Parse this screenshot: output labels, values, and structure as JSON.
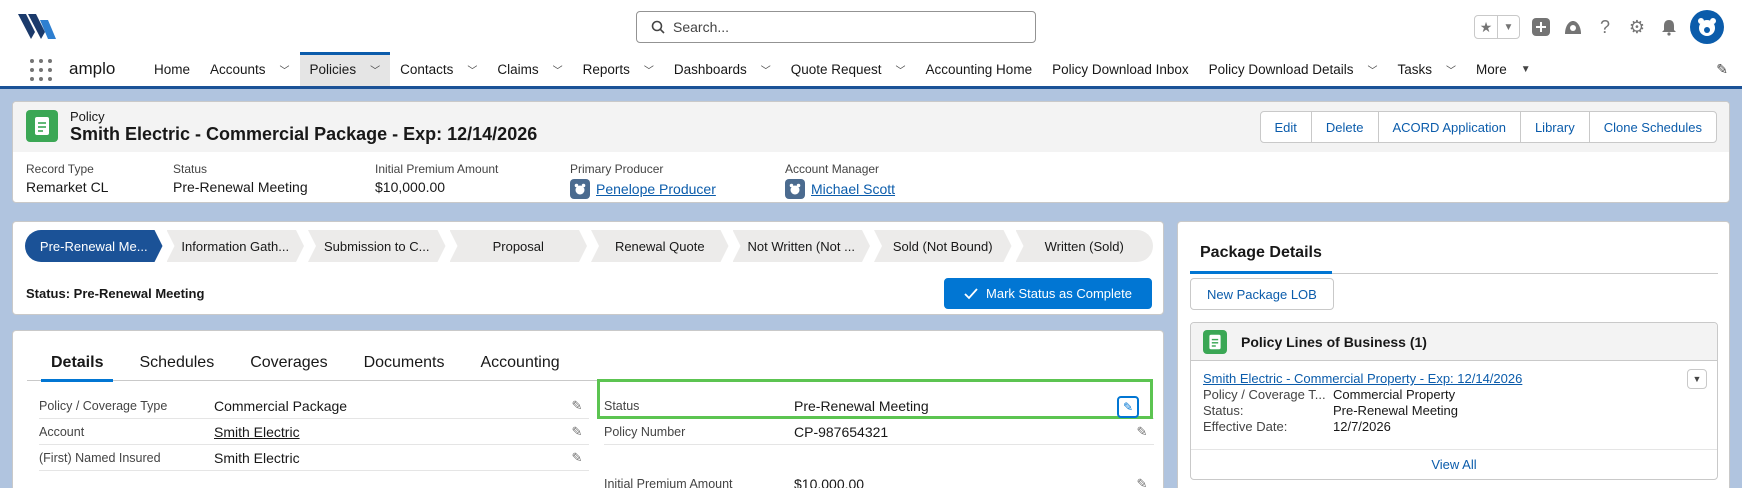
{
  "topbar": {
    "search_placeholder": "Search...",
    "icons": [
      "star-icon",
      "chevron-down-icon",
      "add-icon",
      "trailhead-icon",
      "help-icon",
      "gear-icon",
      "bell-icon",
      "avatar"
    ]
  },
  "nav": {
    "app_name": "amplo",
    "tabs": [
      {
        "label": "Home"
      },
      {
        "label": "Accounts"
      },
      {
        "label": "Policies"
      },
      {
        "label": "Contacts"
      },
      {
        "label": "Claims"
      },
      {
        "label": "Reports"
      },
      {
        "label": "Dashboards"
      },
      {
        "label": "Quote Request"
      },
      {
        "label": "Accounting Home"
      },
      {
        "label": "Policy Download Inbox"
      },
      {
        "label": "Policy Download Details"
      },
      {
        "label": "Tasks"
      },
      {
        "label": "More"
      }
    ]
  },
  "record": {
    "object_label": "Policy",
    "title": "Smith Electric - Commercial Package - Exp: 12/14/2026",
    "actions": [
      "Edit",
      "Delete",
      "ACORD Application",
      "Library",
      "Clone Schedules"
    ],
    "highlights": [
      {
        "label": "Record Type",
        "value": "Remarket CL"
      },
      {
        "label": "Status",
        "value": "Pre-Renewal Meeting"
      },
      {
        "label": "Initial Premium Amount",
        "value": "$10,000.00"
      },
      {
        "label": "Primary Producer",
        "value": "Penelope Producer"
      },
      {
        "label": "Account Manager",
        "value": "Michael Scott"
      }
    ]
  },
  "path": {
    "stages": [
      "Pre-Renewal Me...",
      "Information Gath...",
      "Submission to C...",
      "Proposal",
      "Renewal Quote",
      "Not Written (Not ...",
      "Sold (Not Bound)",
      "Written (Sold)"
    ],
    "status_text": "Status: Pre-Renewal Meeting",
    "mark_button": "Mark Status as Complete"
  },
  "details": {
    "tabs": [
      "Details",
      "Schedules",
      "Coverages",
      "Documents",
      "Accounting"
    ],
    "left_fields": [
      {
        "label": "Policy / Coverage Type",
        "value": "Commercial Package"
      },
      {
        "label": "Account",
        "value": "Smith Electric"
      },
      {
        "label": "(First) Named Insured",
        "value": "Smith Electric"
      }
    ],
    "right_fields": [
      {
        "label": "Status",
        "value": "Pre-Renewal Meeting"
      },
      {
        "label": "Policy Number",
        "value": "CP-987654321"
      },
      {
        "label": "Initial Premium Amount",
        "value": "$10,000.00"
      }
    ]
  },
  "package": {
    "tab": "Package Details",
    "new_button": "New Package LOB",
    "card_title": "Policy Lines of Business (1)",
    "lob_link": "Smith Electric - Commercial Property - Exp: 12/14/2026",
    "lob_fields": [
      {
        "label": "Policy / Coverage T...",
        "value": "Commercial Property"
      },
      {
        "label": "Status:",
        "value": "Pre-Renewal Meeting"
      },
      {
        "label": "Effective Date:",
        "value": "12/7/2026"
      }
    ],
    "view_all": "View All"
  },
  "colors": {
    "brand": "#1b5297",
    "accent": "#0176d3",
    "highlight": "#5cc451",
    "object_icon": "#3ba755"
  }
}
